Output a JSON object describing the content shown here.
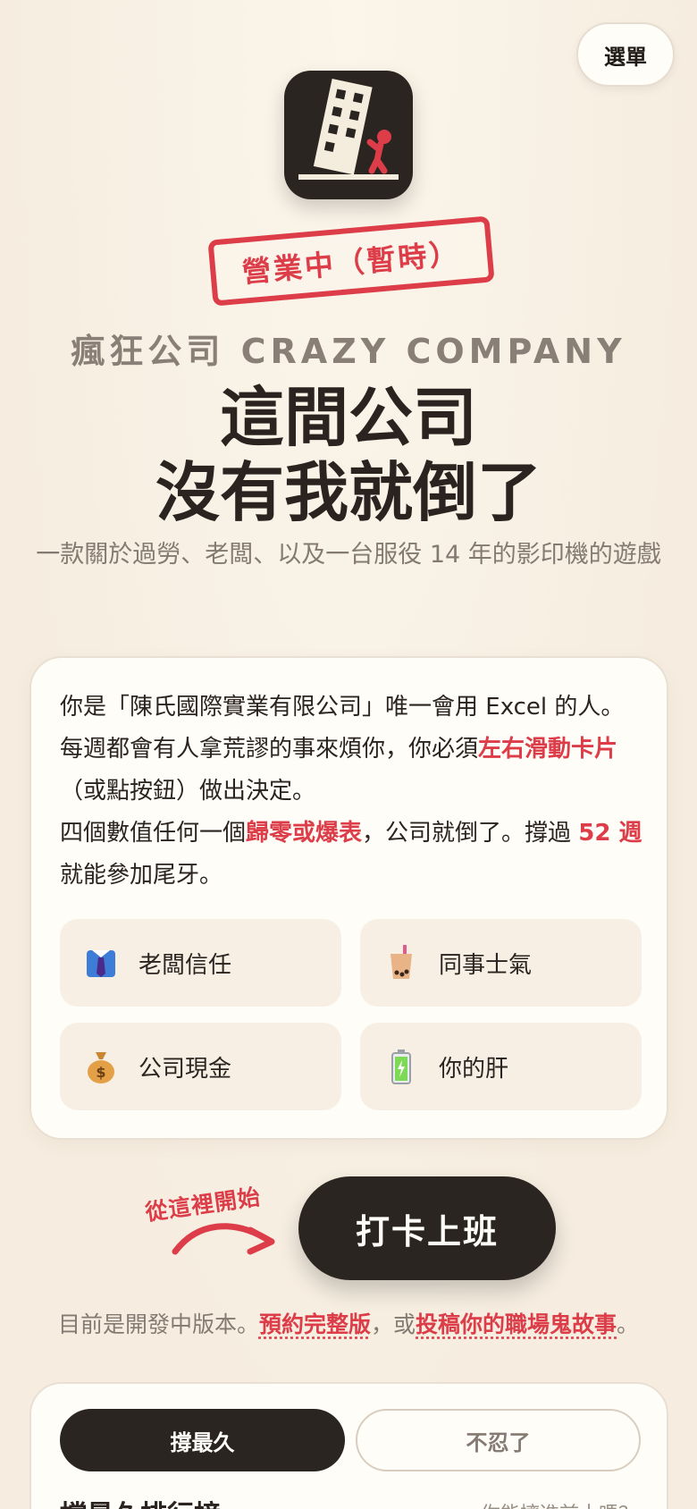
{
  "menu": {
    "label": "選單"
  },
  "logo": {
    "icon": "falling-building-icon"
  },
  "stamp": {
    "text": "營業中（暫時）"
  },
  "brand": {
    "text": "瘋狂公司 CRAZY COMPANY"
  },
  "title": {
    "line1": "這間公司",
    "line2": "沒有我就倒了"
  },
  "subtitle": {
    "text": "一款關於過勞、老闆、以及一台服役 14 年的影印機的遊戲"
  },
  "intro": {
    "p1_a": "你是「陳氏國際實業有限公司」唯一會用 Excel 的人。每週都會有人拿荒謬的事來煩你，你必須",
    "p1_hl": "左右滑動卡片",
    "p1_b": "（或點按鈕）做出決定。",
    "p2_a": "四個數值任何一個",
    "p2_hl": "歸零或爆表",
    "p2_b": "，公司就倒了。撐過 ",
    "p2_hl2": "52 週",
    "p2_c": " 就能參加尾牙。"
  },
  "stats": [
    {
      "icon": "necktie-shirt-icon",
      "label": "老闆信任"
    },
    {
      "icon": "bubble-tea-icon",
      "label": "同事士氣"
    },
    {
      "icon": "money-bag-icon",
      "label": "公司現金"
    },
    {
      "icon": "battery-icon",
      "label": "你的肝"
    }
  ],
  "cta": {
    "hint": "從這裡開始",
    "button": "打卡上班"
  },
  "dev_note": {
    "prefix": "目前是開發中版本。",
    "link1": "預約完整版",
    "middle": "，或",
    "link2": "投稿你的職場鬼故事",
    "suffix": "。"
  },
  "leaderboard": {
    "tabs": [
      "撐最久",
      "不忍了"
    ],
    "title": "撐最久排行榜",
    "hint": "你能擠進前十嗎？"
  },
  "colors": {
    "accent": "#dc3d48",
    "dark": "#2b2522",
    "background": "#f8f0e4",
    "card": "#fffdf8"
  }
}
